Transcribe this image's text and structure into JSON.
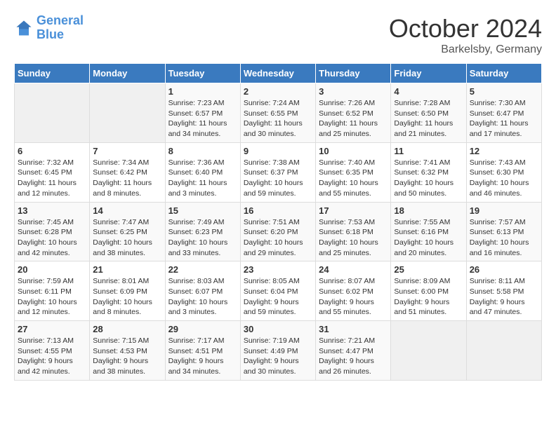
{
  "header": {
    "logo_line1": "General",
    "logo_line2": "Blue",
    "month": "October 2024",
    "location": "Barkelsby, Germany"
  },
  "columns": [
    "Sunday",
    "Monday",
    "Tuesday",
    "Wednesday",
    "Thursday",
    "Friday",
    "Saturday"
  ],
  "weeks": [
    [
      {
        "day": "",
        "info": ""
      },
      {
        "day": "",
        "info": ""
      },
      {
        "day": "1",
        "info": "Sunrise: 7:23 AM\nSunset: 6:57 PM\nDaylight: 11 hours\nand 34 minutes."
      },
      {
        "day": "2",
        "info": "Sunrise: 7:24 AM\nSunset: 6:55 PM\nDaylight: 11 hours\nand 30 minutes."
      },
      {
        "day": "3",
        "info": "Sunrise: 7:26 AM\nSunset: 6:52 PM\nDaylight: 11 hours\nand 25 minutes."
      },
      {
        "day": "4",
        "info": "Sunrise: 7:28 AM\nSunset: 6:50 PM\nDaylight: 11 hours\nand 21 minutes."
      },
      {
        "day": "5",
        "info": "Sunrise: 7:30 AM\nSunset: 6:47 PM\nDaylight: 11 hours\nand 17 minutes."
      }
    ],
    [
      {
        "day": "6",
        "info": "Sunrise: 7:32 AM\nSunset: 6:45 PM\nDaylight: 11 hours\nand 12 minutes."
      },
      {
        "day": "7",
        "info": "Sunrise: 7:34 AM\nSunset: 6:42 PM\nDaylight: 11 hours\nand 8 minutes."
      },
      {
        "day": "8",
        "info": "Sunrise: 7:36 AM\nSunset: 6:40 PM\nDaylight: 11 hours\nand 3 minutes."
      },
      {
        "day": "9",
        "info": "Sunrise: 7:38 AM\nSunset: 6:37 PM\nDaylight: 10 hours\nand 59 minutes."
      },
      {
        "day": "10",
        "info": "Sunrise: 7:40 AM\nSunset: 6:35 PM\nDaylight: 10 hours\nand 55 minutes."
      },
      {
        "day": "11",
        "info": "Sunrise: 7:41 AM\nSunset: 6:32 PM\nDaylight: 10 hours\nand 50 minutes."
      },
      {
        "day": "12",
        "info": "Sunrise: 7:43 AM\nSunset: 6:30 PM\nDaylight: 10 hours\nand 46 minutes."
      }
    ],
    [
      {
        "day": "13",
        "info": "Sunrise: 7:45 AM\nSunset: 6:28 PM\nDaylight: 10 hours\nand 42 minutes."
      },
      {
        "day": "14",
        "info": "Sunrise: 7:47 AM\nSunset: 6:25 PM\nDaylight: 10 hours\nand 38 minutes."
      },
      {
        "day": "15",
        "info": "Sunrise: 7:49 AM\nSunset: 6:23 PM\nDaylight: 10 hours\nand 33 minutes."
      },
      {
        "day": "16",
        "info": "Sunrise: 7:51 AM\nSunset: 6:20 PM\nDaylight: 10 hours\nand 29 minutes."
      },
      {
        "day": "17",
        "info": "Sunrise: 7:53 AM\nSunset: 6:18 PM\nDaylight: 10 hours\nand 25 minutes."
      },
      {
        "day": "18",
        "info": "Sunrise: 7:55 AM\nSunset: 6:16 PM\nDaylight: 10 hours\nand 20 minutes."
      },
      {
        "day": "19",
        "info": "Sunrise: 7:57 AM\nSunset: 6:13 PM\nDaylight: 10 hours\nand 16 minutes."
      }
    ],
    [
      {
        "day": "20",
        "info": "Sunrise: 7:59 AM\nSunset: 6:11 PM\nDaylight: 10 hours\nand 12 minutes."
      },
      {
        "day": "21",
        "info": "Sunrise: 8:01 AM\nSunset: 6:09 PM\nDaylight: 10 hours\nand 8 minutes."
      },
      {
        "day": "22",
        "info": "Sunrise: 8:03 AM\nSunset: 6:07 PM\nDaylight: 10 hours\nand 3 minutes."
      },
      {
        "day": "23",
        "info": "Sunrise: 8:05 AM\nSunset: 6:04 PM\nDaylight: 9 hours\nand 59 minutes."
      },
      {
        "day": "24",
        "info": "Sunrise: 8:07 AM\nSunset: 6:02 PM\nDaylight: 9 hours\nand 55 minutes."
      },
      {
        "day": "25",
        "info": "Sunrise: 8:09 AM\nSunset: 6:00 PM\nDaylight: 9 hours\nand 51 minutes."
      },
      {
        "day": "26",
        "info": "Sunrise: 8:11 AM\nSunset: 5:58 PM\nDaylight: 9 hours\nand 47 minutes."
      }
    ],
    [
      {
        "day": "27",
        "info": "Sunrise: 7:13 AM\nSunset: 4:55 PM\nDaylight: 9 hours\nand 42 minutes."
      },
      {
        "day": "28",
        "info": "Sunrise: 7:15 AM\nSunset: 4:53 PM\nDaylight: 9 hours\nand 38 minutes."
      },
      {
        "day": "29",
        "info": "Sunrise: 7:17 AM\nSunset: 4:51 PM\nDaylight: 9 hours\nand 34 minutes."
      },
      {
        "day": "30",
        "info": "Sunrise: 7:19 AM\nSunset: 4:49 PM\nDaylight: 9 hours\nand 30 minutes."
      },
      {
        "day": "31",
        "info": "Sunrise: 7:21 AM\nSunset: 4:47 PM\nDaylight: 9 hours\nand 26 minutes."
      },
      {
        "day": "",
        "info": ""
      },
      {
        "day": "",
        "info": ""
      }
    ]
  ]
}
